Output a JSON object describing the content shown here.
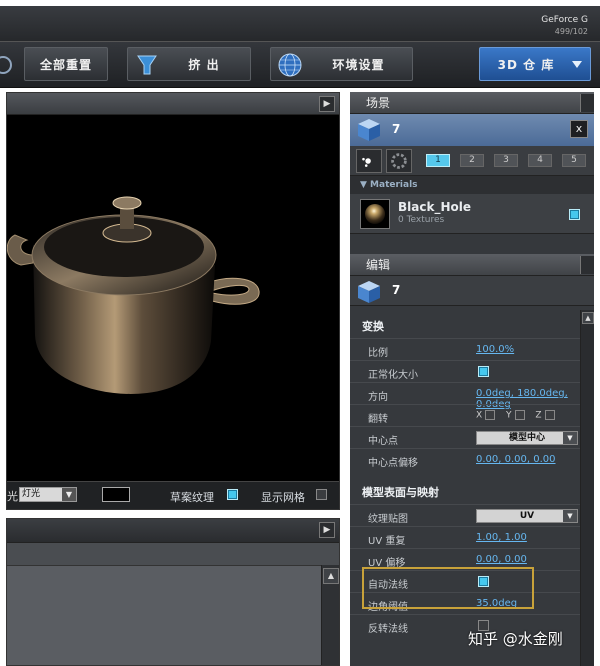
{
  "gpu": {
    "line1": "GeForce G",
    "line2": "499/102"
  },
  "toolbar": {
    "reset_label": "全部重置",
    "extrude_label": "挤 出",
    "env_label": "环境设置",
    "warehouse_label": "3D 仓 库"
  },
  "viewport": {
    "bottom_left_text": "光",
    "light_select": "灯光",
    "draft_texture_label": "草案纹理",
    "show_grid_label": "显示网格"
  },
  "scene": {
    "title": "场景",
    "object_name": "7",
    "close_label": "x",
    "pages": [
      "1",
      "2",
      "3",
      "4",
      "5"
    ],
    "materials_label": "▼ Materials",
    "material_name": "Black_Hole",
    "material_sub": "0 Textures"
  },
  "edit": {
    "title": "编辑",
    "object_name": "7",
    "transform_title": "变换",
    "scale_label": "比例",
    "scale_value": "100.0%",
    "normalize_label": "正常化大小",
    "orientation_label": "方向",
    "orientation_value": "0.0deg, 180.0deg, 0.0deg",
    "flip_label": "翻转",
    "flip_x": "X",
    "flip_y": "Y",
    "flip_z": "Z",
    "pivot_label": "中心点",
    "pivot_value": "模型中心",
    "pivot_offset_label": "中心点偏移",
    "pivot_offset_value": "0.00, 0.00, 0.00",
    "surface_title": "模型表面与映射",
    "texmap_label": "纹理贴图",
    "texmap_value": "UV",
    "uv_repeat_label": "UV 重复",
    "uv_repeat_value": "1.00, 1.00",
    "uv_offset_label": "UV 偏移",
    "uv_offset_value": "0.00, 0.00",
    "auto_normal_label": "自动法线",
    "crease_label": "边角阈值",
    "crease_value": "35.0deg",
    "flip_normal_label": "反转法线"
  },
  "watermark": "知乎 @水金刚",
  "colors": {
    "accent": "#45c8ee",
    "highlight": "#c8a23a",
    "link": "#66b7f0"
  }
}
